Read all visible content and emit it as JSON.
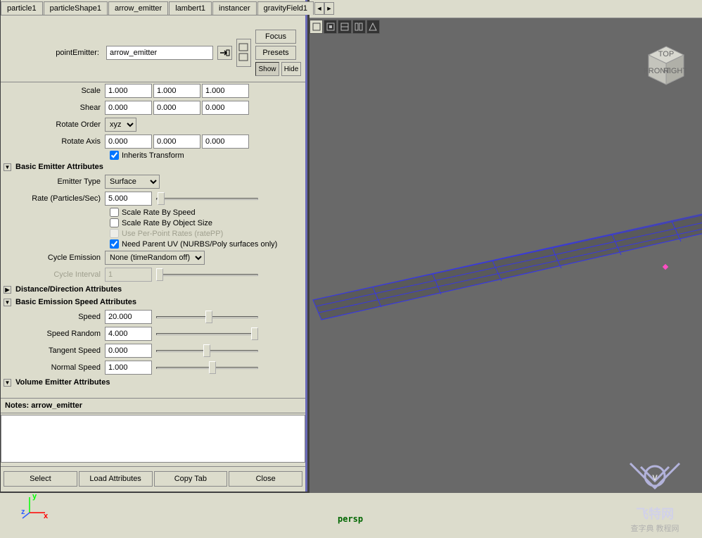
{
  "tabs": [
    "particle1",
    "particleShape1",
    "arrow_emitter",
    "lambert1",
    "instancer",
    "gravityField1"
  ],
  "active_tab": 2,
  "pointEmitter_label": "pointEmitter:",
  "emitter_name": "arrow_emitter",
  "buttons": {
    "focus": "Focus",
    "presets": "Presets",
    "show": "Show",
    "hide": "Hide"
  },
  "transform": {
    "scale_label": "Scale",
    "scale": [
      "1.000",
      "1.000",
      "1.000"
    ],
    "shear_label": "Shear",
    "shear": [
      "0.000",
      "0.000",
      "0.000"
    ],
    "rotate_order_label": "Rotate Order",
    "rotate_order": "xyz",
    "rotate_axis_label": "Rotate Axis",
    "rotate_axis": [
      "0.000",
      "0.000",
      "0.000"
    ],
    "inherits_label": "Inherits Transform",
    "inherits": true
  },
  "sections": {
    "basic_emitter": "Basic Emitter Attributes",
    "distance": "Distance/Direction Attributes",
    "basic_speed": "Basic Emission Speed Attributes",
    "volume": "Volume Emitter Attributes"
  },
  "emitter": {
    "type_label": "Emitter Type",
    "type": "Surface",
    "rate_label": "Rate (Particles/Sec)",
    "rate": "5.000",
    "scale_by_speed": "Scale Rate By Speed",
    "scale_by_size": "Scale Rate By Object Size",
    "per_point": "Use Per-Point Rates (ratePP)",
    "need_parent_uv": "Need Parent UV (NURBS/Poly surfaces only)",
    "need_parent_uv_checked": true,
    "cycle_emission_label": "Cycle Emission",
    "cycle_emission": "None (timeRandom off)",
    "cycle_interval_label": "Cycle Interval",
    "cycle_interval": "1"
  },
  "speed": {
    "speed_label": "Speed",
    "speed": "20.000",
    "random_label": "Speed Random",
    "random": "4.000",
    "tangent_label": "Tangent Speed",
    "tangent": "0.000",
    "normal_label": "Normal Speed",
    "normal": "1.000"
  },
  "notes_label": "Notes: arrow_emitter",
  "notes_value": "",
  "bottom": {
    "select": "Select",
    "load": "Load Attributes",
    "copy": "Copy Tab",
    "close": "Close"
  },
  "viewport": {
    "label": "persp",
    "cube_top": "TOP",
    "cube_front": "FRONT",
    "cube_right": "RIGHT"
  },
  "axis": {
    "x": "x",
    "y": "y",
    "z": "z"
  },
  "watermark": {
    "logo": "V",
    "site": "飞特网",
    "sub": "查字典 教程网"
  }
}
